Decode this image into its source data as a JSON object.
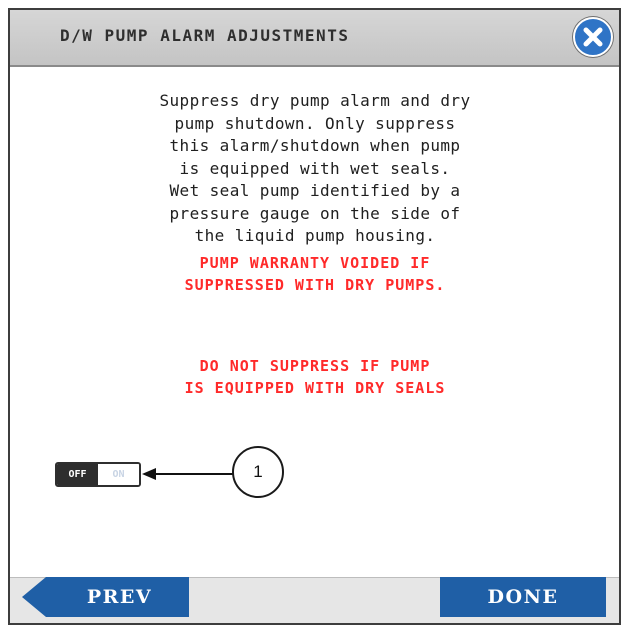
{
  "header": {
    "title": "D/W PUMP ALARM ADJUSTMENTS",
    "close_icon": "close-icon"
  },
  "body": {
    "lines": [
      "Suppress dry pump alarm and dry",
      "pump shutdown. Only suppress",
      "this alarm/shutdown when pump",
      "is equipped with wet seals.",
      "Wet seal pump identified by a",
      "pressure gauge on the side of",
      "the liquid pump housing."
    ]
  },
  "warnings": {
    "warranty": [
      "PUMP WARRANTY VOIDED IF",
      "SUPPRESSED WITH DRY PUMPS."
    ],
    "dry_seals": [
      "DO NOT SUPPRESS IF PUMP",
      "IS EQUIPPED WITH DRY SEALS"
    ]
  },
  "toggle": {
    "off_label": "OFF",
    "on_label": "ON",
    "state": "OFF"
  },
  "callout": {
    "number": "1"
  },
  "footer": {
    "prev_label": "PREV",
    "done_label": "DONE"
  },
  "colors": {
    "warning": "#ff2a2a",
    "button_blue": "#1f5fa6",
    "close_blue": "#2f74c6"
  }
}
